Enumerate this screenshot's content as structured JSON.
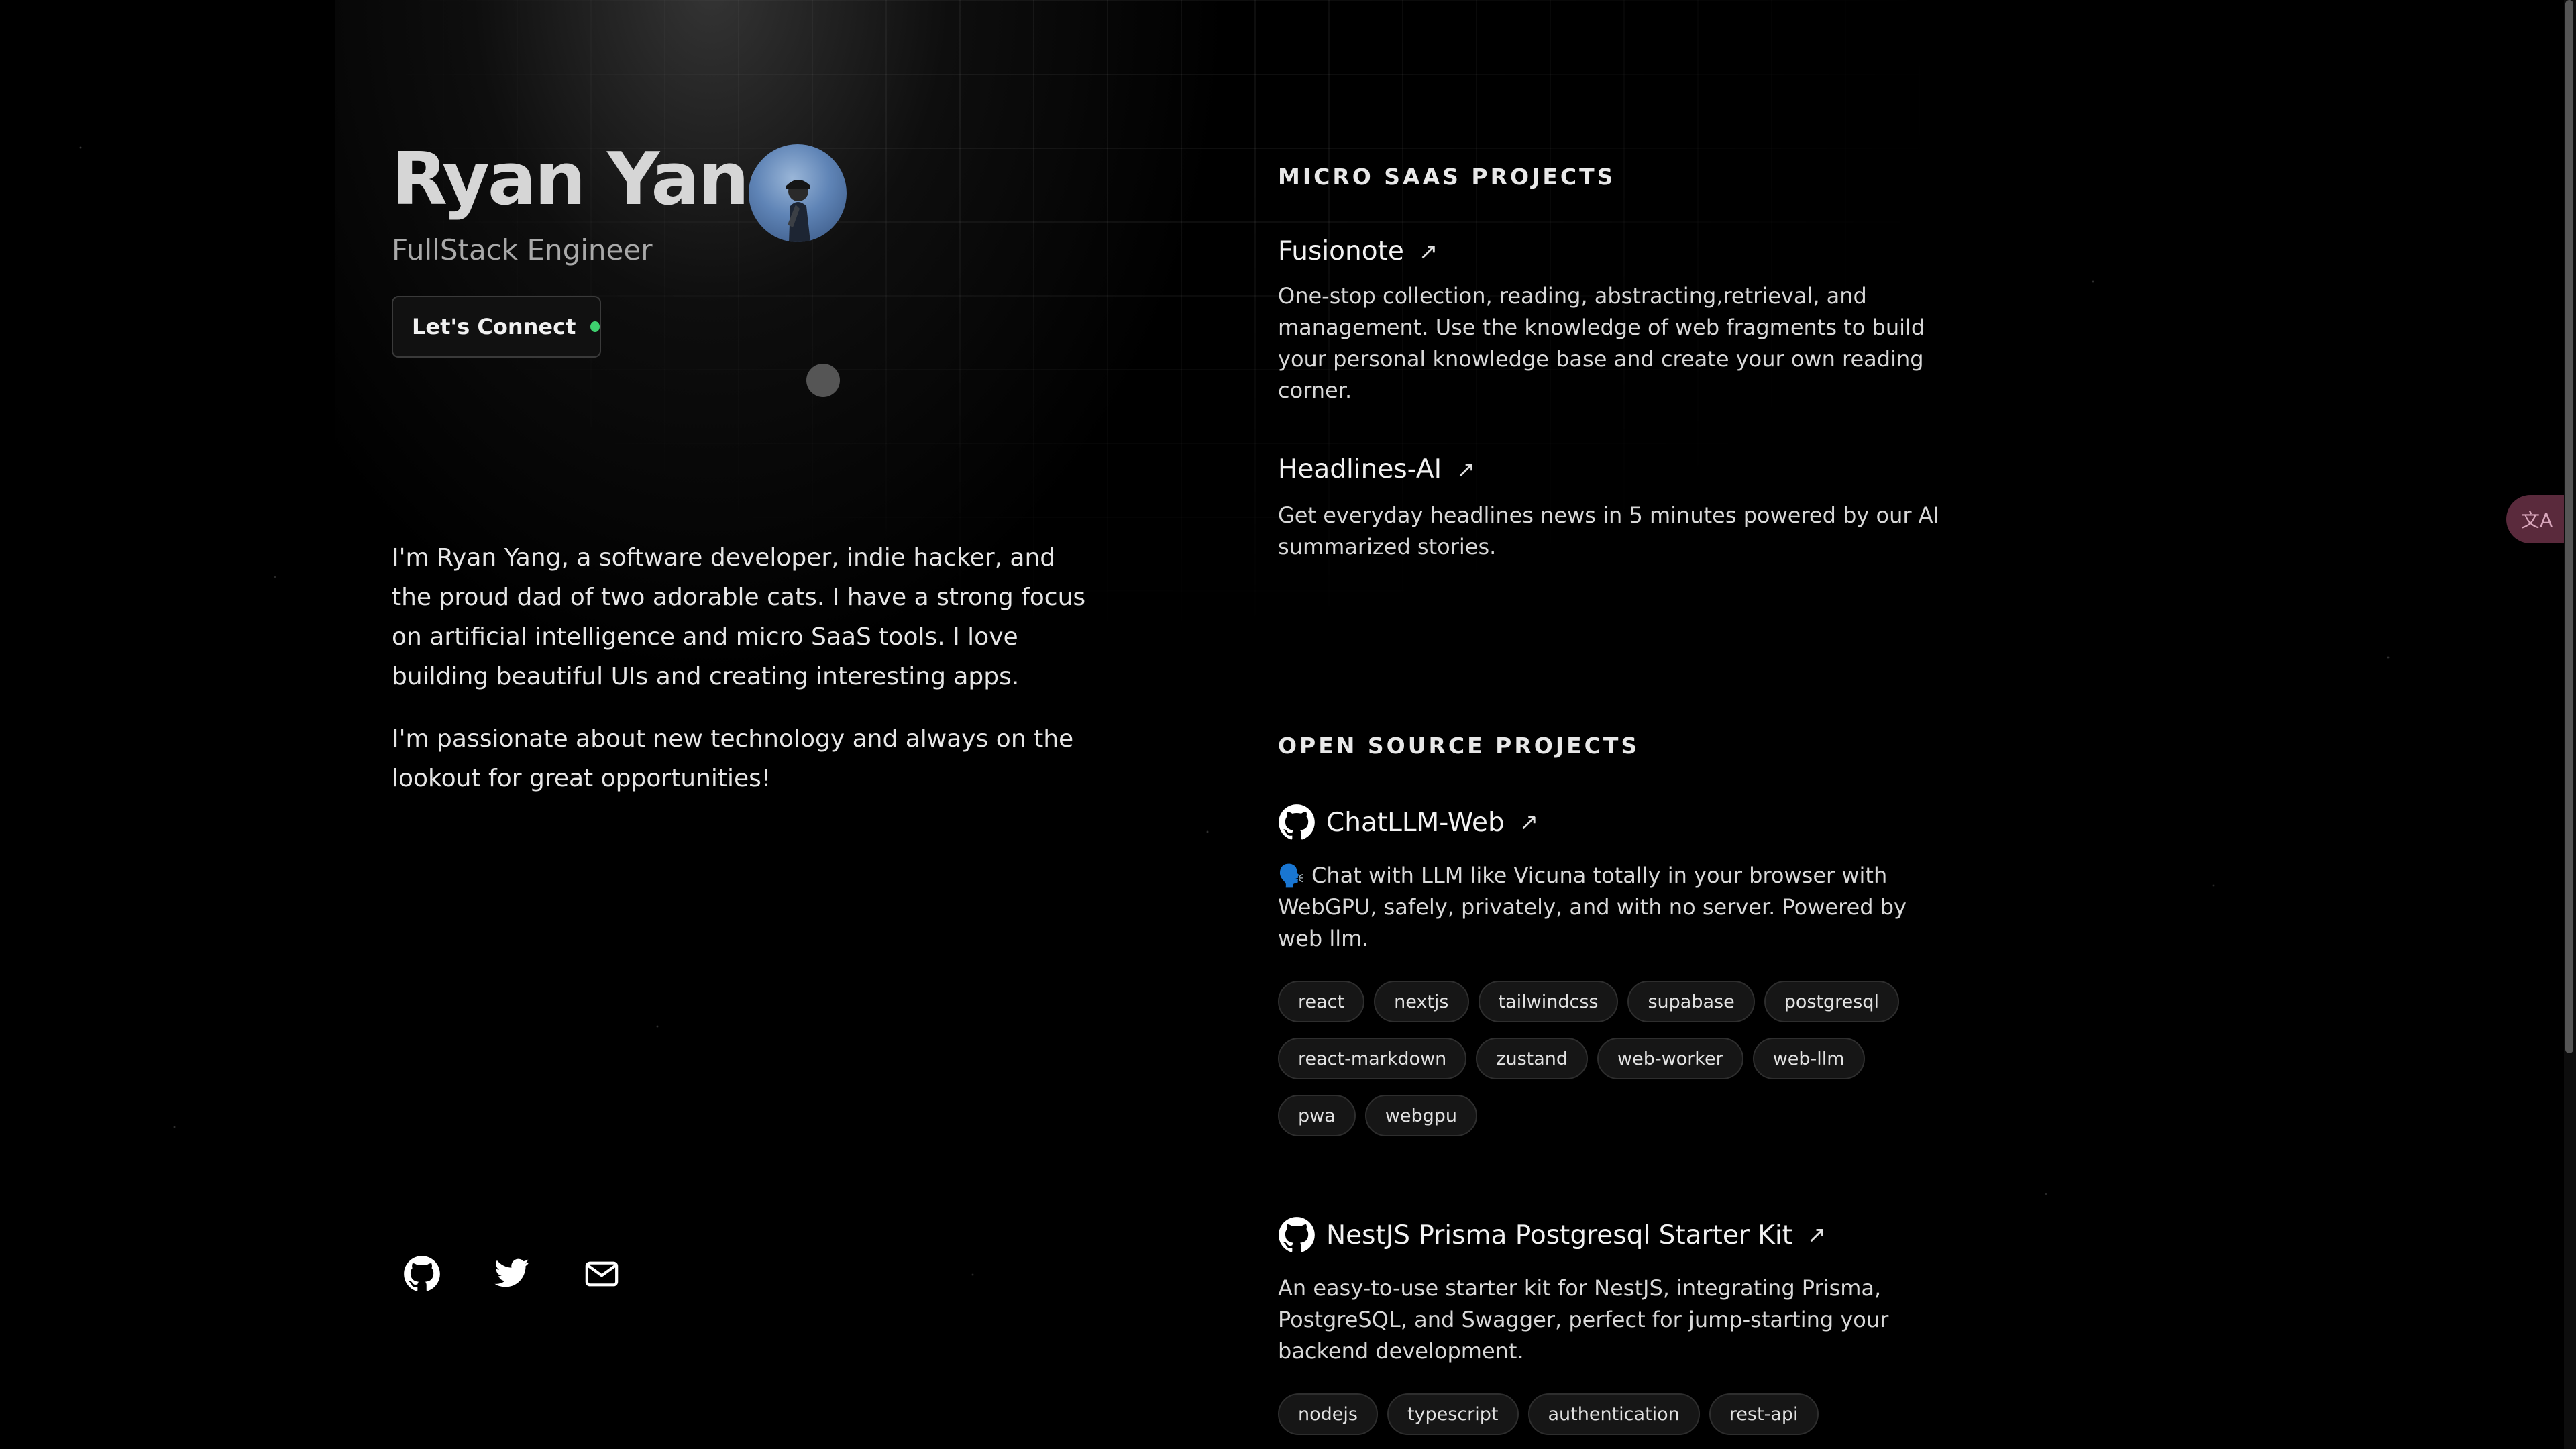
{
  "profile": {
    "name": "Ryan Yang",
    "role": "FullStack Engineer",
    "connect_label": "Let's Connect",
    "bio": [
      "I'm Ryan Yang, a software developer, indie hacker, and the proud dad of two adorable cats. I have a strong focus on artificial intelligence and micro SaaS tools. I love building beautiful UIs and creating interesting apps.",
      "I'm passionate about new technology and always on the lookout for great opportunities!"
    ],
    "social": [
      {
        "icon": "github-icon"
      },
      {
        "icon": "twitter-icon"
      },
      {
        "icon": "mail-icon"
      }
    ]
  },
  "micro_saas": {
    "heading": "MICRO SAAS PROJECTS",
    "projects": [
      {
        "title": "Fusionote",
        "arrow": "↗",
        "description": "One-stop collection, reading, abstracting,retrieval, and management. Use the knowledge of web fragments to build your personal knowledge base and create your own reading corner."
      },
      {
        "title": "Headlines-AI",
        "arrow": "↗",
        "description": "Get everyday headlines news in 5 minutes powered by our AI summarized stories."
      }
    ]
  },
  "open_source": {
    "heading": "OPEN SOURCE PROJECTS",
    "projects": [
      {
        "title": "ChatLLM-Web",
        "arrow": "↗",
        "description": "🗣️ Chat with LLM like Vicuna totally in your browser with WebGPU, safely, privately, and with no server. Powered by web llm.",
        "tags": [
          "react",
          "nextjs",
          "tailwindcss",
          "supabase",
          "postgresql",
          "react-markdown",
          "zustand",
          "web-worker",
          "web-llm",
          "pwa",
          "webgpu"
        ]
      },
      {
        "title": "NestJS Prisma Postgresql Starter Kit",
        "arrow": "↗",
        "description": "An easy-to-use starter kit for NestJS, integrating Prisma, PostgreSQL, and Swagger, perfect for jump-starting your backend development.",
        "tags": [
          "nodejs",
          "typescript",
          "authentication",
          "rest-api"
        ]
      }
    ]
  },
  "colors": {
    "background": "#000000",
    "status_dot": "#3ecf6e",
    "translate_button": "#5a2a3c"
  },
  "translate_button": {
    "label": "文A",
    "icon": "translate-icon"
  }
}
